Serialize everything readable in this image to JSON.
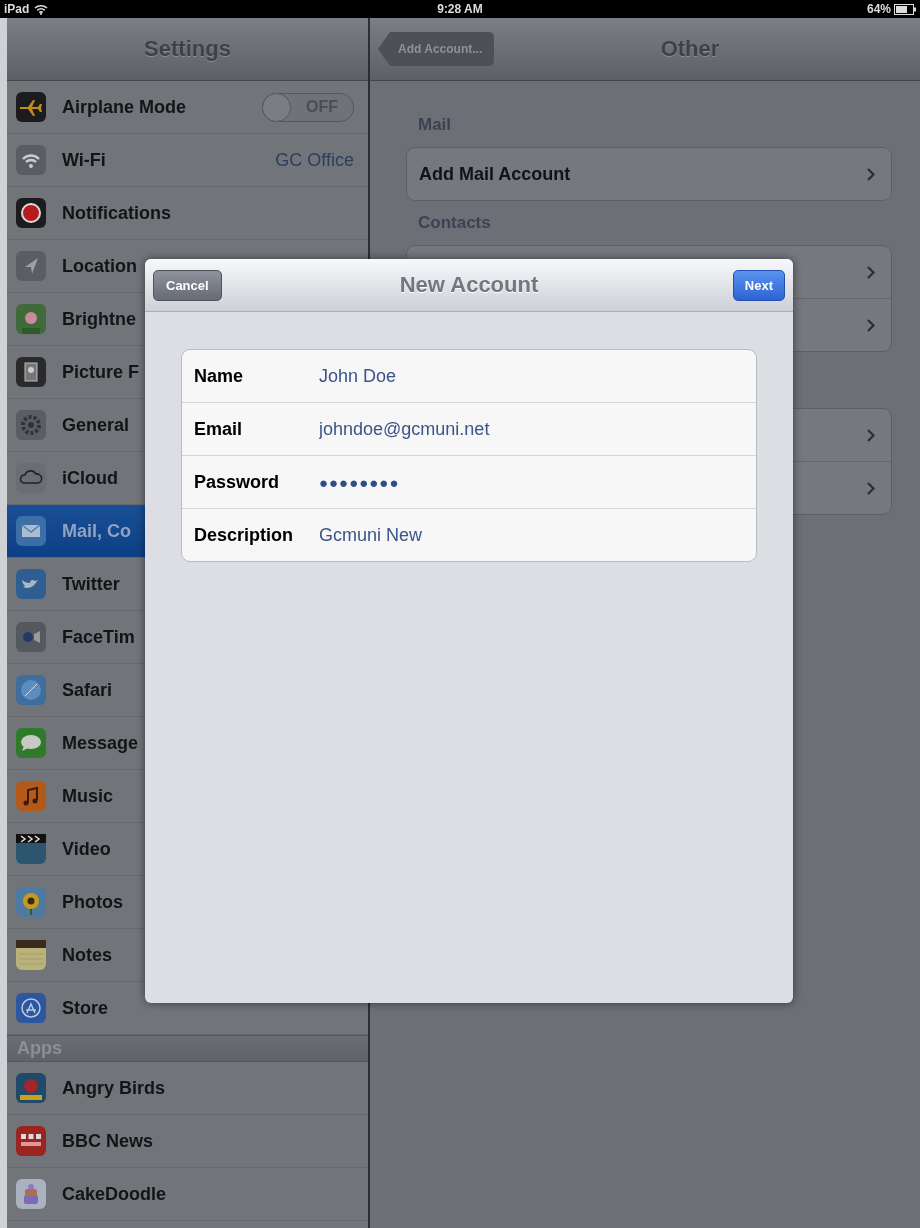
{
  "status_bar": {
    "device": "iPad",
    "time": "9:28 AM",
    "battery": "64%"
  },
  "sidebar": {
    "title": "Settings",
    "items": [
      {
        "label": "Airplane Mode",
        "kind": "toggle",
        "on": false,
        "toggle_label": "OFF",
        "selected": false
      },
      {
        "label": "Wi-Fi",
        "kind": "value",
        "value": "GC Office",
        "selected": false
      },
      {
        "label": "Notifications",
        "kind": "link",
        "selected": false
      },
      {
        "label": "Location",
        "kind": "link",
        "selected": false
      },
      {
        "label": "Brightne",
        "kind": "link",
        "selected": false
      },
      {
        "label": "Picture F",
        "kind": "link",
        "selected": false
      },
      {
        "label": "General",
        "kind": "link",
        "selected": false
      },
      {
        "label": "iCloud",
        "kind": "link",
        "selected": false
      },
      {
        "label": "Mail, Co",
        "kind": "link",
        "selected": true
      },
      {
        "label": "Twitter",
        "kind": "link",
        "selected": false
      },
      {
        "label": "FaceTim",
        "kind": "link",
        "selected": false
      },
      {
        "label": "Safari",
        "kind": "link",
        "selected": false
      },
      {
        "label": "Message",
        "kind": "link",
        "selected": false
      },
      {
        "label": "Music",
        "kind": "link",
        "selected": false
      },
      {
        "label": "Video",
        "kind": "link",
        "selected": false
      },
      {
        "label": "Photos",
        "kind": "link",
        "selected": false
      },
      {
        "label": "Notes",
        "kind": "link",
        "selected": false
      },
      {
        "label": "Store",
        "kind": "link",
        "selected": false
      }
    ],
    "apps_header": "Apps",
    "apps": [
      {
        "label": "Angry Birds",
        "selected": false
      },
      {
        "label": "BBC News",
        "selected": false
      },
      {
        "label": "CakeDoodle",
        "selected": false
      }
    ]
  },
  "detail": {
    "back_button": "Add Account...",
    "title": "Other",
    "sections": [
      {
        "header": "Mail",
        "rows": [
          {
            "label": "Add Mail Account",
            "chevron": true
          }
        ]
      },
      {
        "header": "Contacts",
        "rows": [
          {
            "chevron": true
          },
          {
            "chevron": true
          }
        ]
      },
      {
        "rows": [
          {
            "chevron": true
          },
          {
            "chevron": true
          }
        ]
      }
    ]
  },
  "sheet": {
    "cancel_button": "Cancel",
    "title": "New Account",
    "next_button": "Next",
    "fields": [
      {
        "label": "Name",
        "value": "John Doe",
        "kind": "text"
      },
      {
        "label": "Email",
        "value": "johndoe@gcmuni.net",
        "kind": "text"
      },
      {
        "label": "Password",
        "value": "●●●●●●●●",
        "kind": "secure"
      },
      {
        "label": "Description",
        "value": "Gcmuni New",
        "kind": "text"
      }
    ]
  }
}
